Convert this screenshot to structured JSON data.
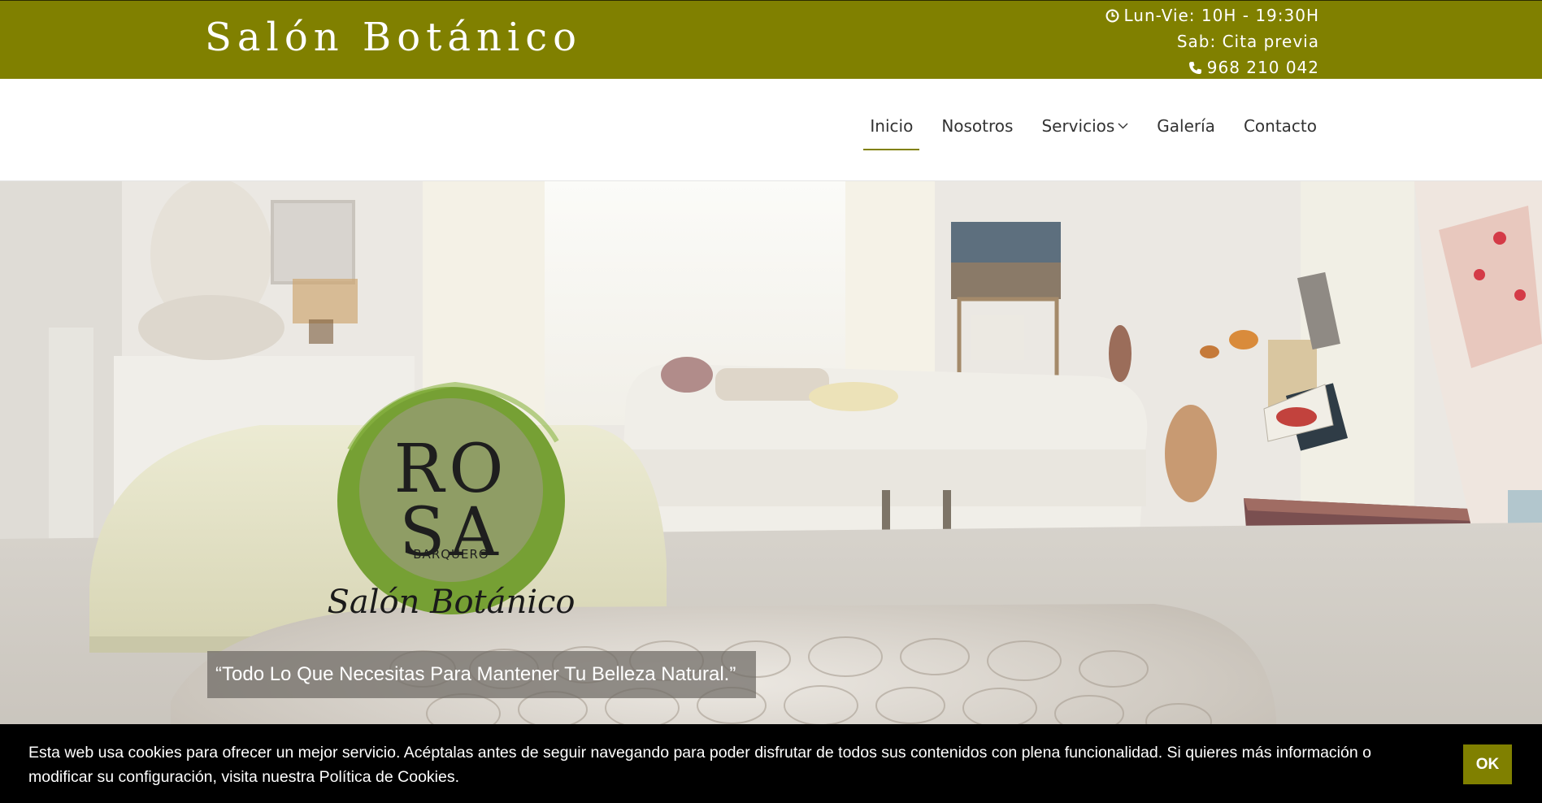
{
  "topbar": {
    "brand": "Salón Botánico",
    "hours_weekdays": "Lun-Vie: 10H - 19:30H",
    "hours_saturday": "Sab: Cita previa",
    "phone": "968 210 042",
    "background_color": "#808000",
    "clock_icon": "clock-icon",
    "phone_icon": "phone-icon"
  },
  "nav": {
    "items": [
      {
        "label": "Inicio",
        "active": true
      },
      {
        "label": "Nosotros"
      },
      {
        "label": "Servicios",
        "has_dropdown": true
      },
      {
        "label": "Galería"
      },
      {
        "label": "Contacto"
      }
    ],
    "accent_color": "#808000"
  },
  "hero": {
    "logo": {
      "line1": "RO",
      "line2": "SA",
      "subtitle": "BARQUERO",
      "script": "Salón Botánico",
      "ring_color": "#78a035"
    },
    "tagline": "“Todo Lo Que Necesitas Para Mantener Tu Belleza Natural.”"
  },
  "cookie_bar": {
    "text": "Esta web usa cookies para ofrecer un mejor servicio. Acéptalas antes de seguir navegando para poder disfrutar de todos sus contenidos con plena funcionalidad. Si quieres más información o modificar su configuración, visita nuestra Política de Cookies.",
    "ok_label": "OK"
  }
}
